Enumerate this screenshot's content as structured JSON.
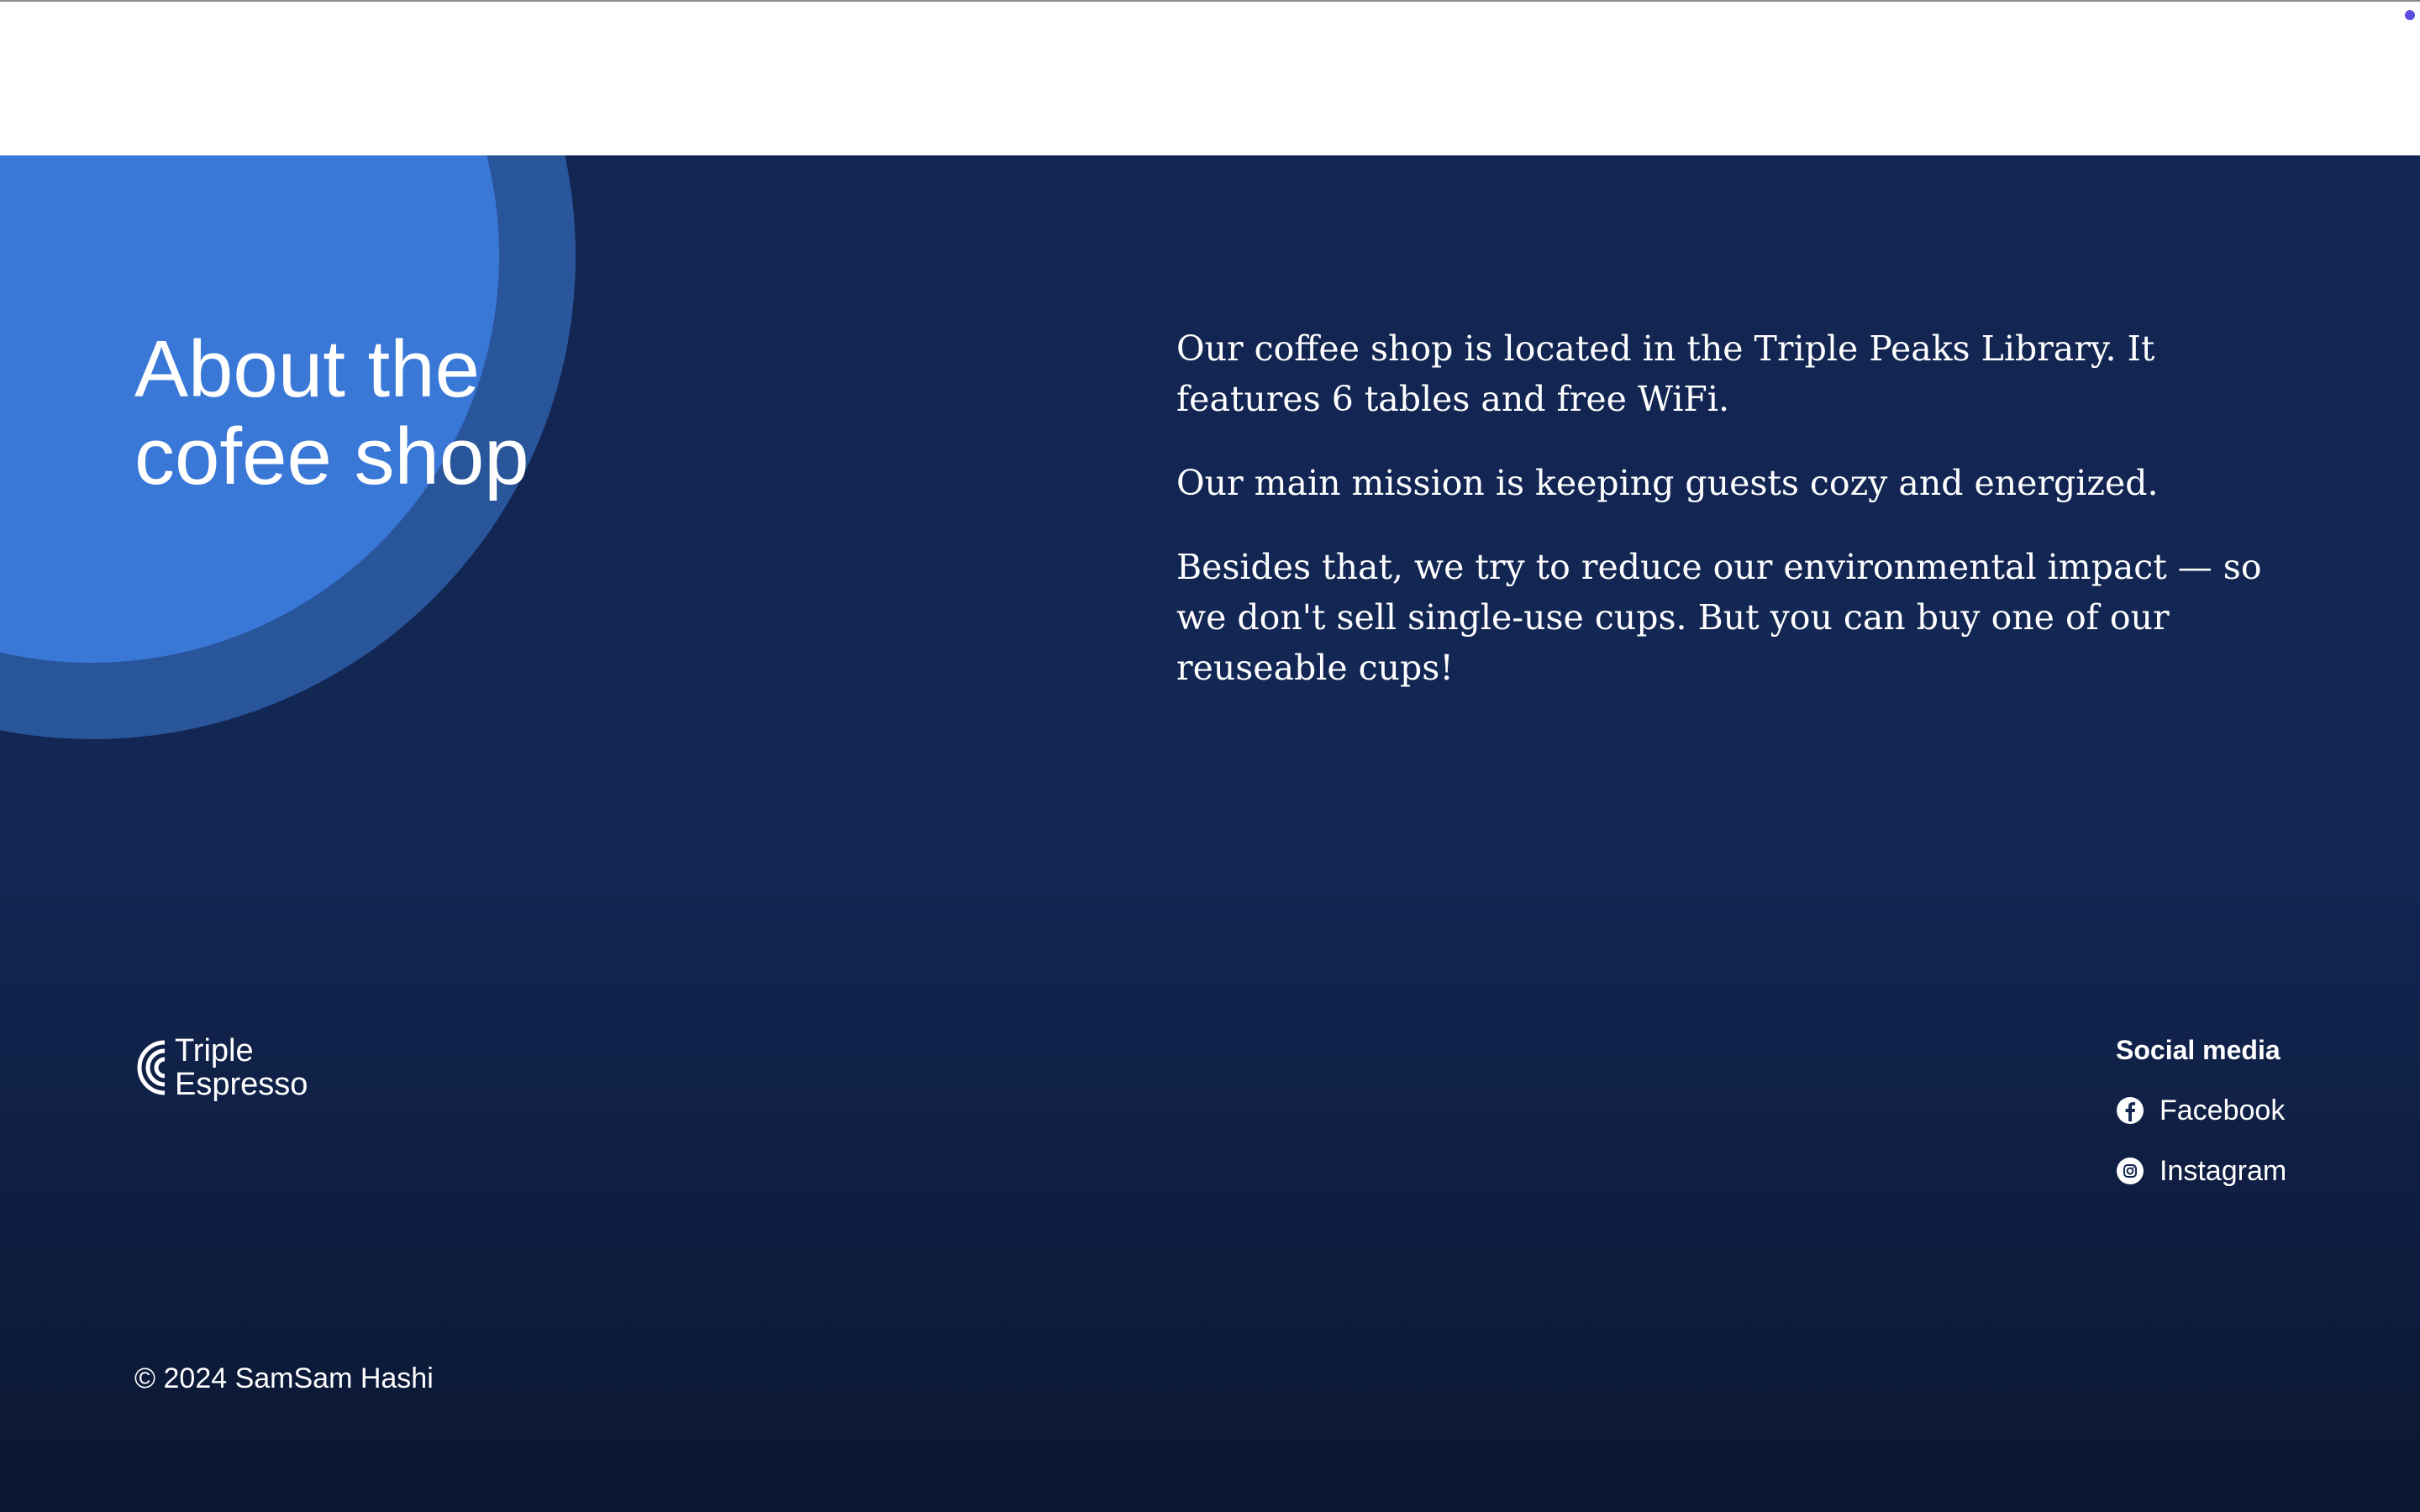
{
  "about": {
    "title_line1": "About the",
    "title_line2": "cofee shop",
    "paragraphs": [
      "Our coffee shop is located in the Triple Peaks Library. It features 6 tables and free WiFi.",
      "Our main mission is keeping guests cozy and energized.",
      "Besides that, we try to reduce our environmental impact — so we don't sell single-use cups. But you can buy one of our reuseable cups!"
    ]
  },
  "footer": {
    "logo": {
      "line1": "Triple",
      "line2": "Espresso"
    },
    "social": {
      "title": "Social media",
      "items": [
        {
          "label": "Facebook",
          "icon": "facebook-icon"
        },
        {
          "label": "Instagram",
          "icon": "instagram-icon"
        }
      ]
    },
    "copyright": "© 2024 SamSam Hashi"
  },
  "colors": {
    "background_navy": "#132652",
    "circle_outer": "#29559b",
    "circle_inner": "#3a78d8",
    "text": "#ffffff",
    "indicator": "#5b4fe0"
  }
}
